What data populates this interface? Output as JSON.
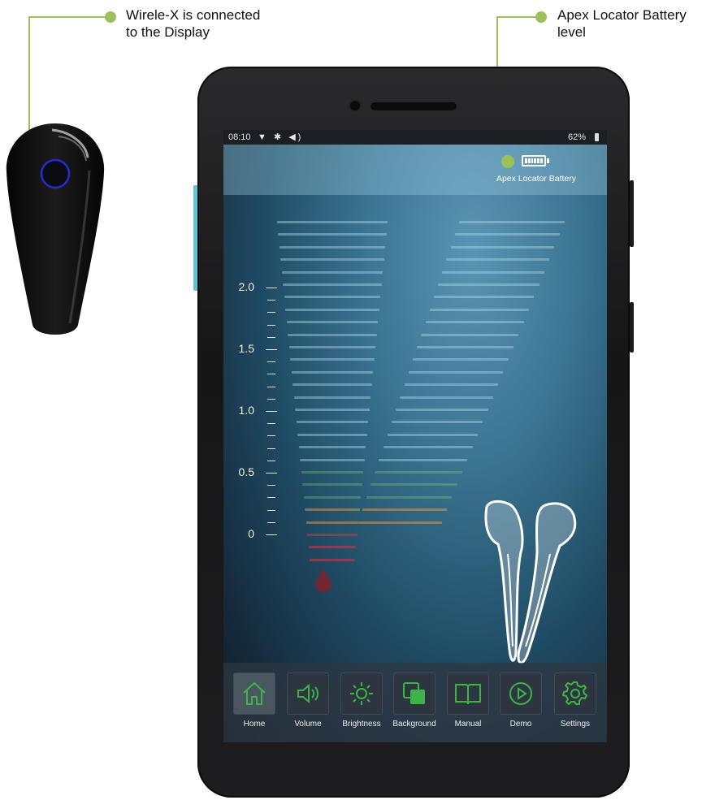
{
  "annotations": {
    "remote": "Wirele-X is connected\nto the Display",
    "battery": "Apex Locator Battery\nlevel"
  },
  "status_bar": {
    "time": "08:10",
    "icons": "▼ ✱ ◀)",
    "battery_percent": "62%"
  },
  "battery_widget": {
    "label": "Apex Locator Battery",
    "icon": "battery-full-icon"
  },
  "scale": {
    "labels": [
      "2.0",
      "1.5",
      "1.0",
      "0.5",
      "0"
    ]
  },
  "nav": {
    "items": [
      {
        "label": "Home",
        "icon": "home-icon"
      },
      {
        "label": "Volume",
        "icon": "volume-icon"
      },
      {
        "label": "Brightness",
        "icon": "sun-icon"
      },
      {
        "label": "Background",
        "icon": "layers-icon"
      },
      {
        "label": "Manual",
        "icon": "book-info-icon"
      },
      {
        "label": "Demo",
        "icon": "play-icon"
      },
      {
        "label": "Settings",
        "icon": "gear-icon"
      }
    ]
  },
  "colors": {
    "accent_green": "#9cc05a",
    "nav_icon_green": "#3fb34a",
    "screen_blue": "#3b7592"
  }
}
